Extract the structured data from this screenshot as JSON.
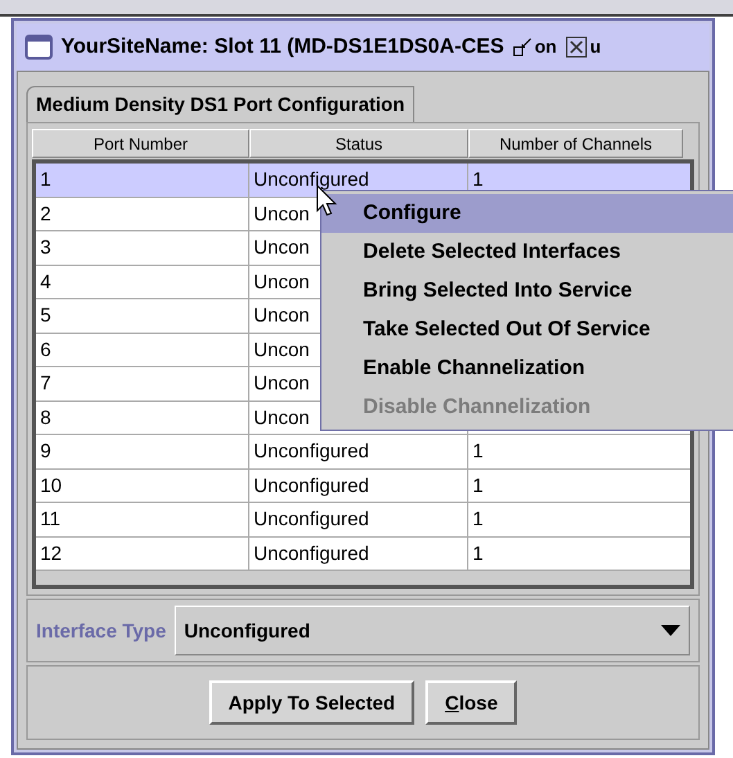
{
  "window": {
    "title": "YourSiteName: Slot 11 (MD-DS1E1DS0A-CES",
    "title_fragments": [
      "on",
      "u"
    ]
  },
  "tabs": [
    {
      "label": "Medium Density DS1 Port Configuration",
      "selected": true
    }
  ],
  "table": {
    "columns": [
      "Port Number",
      "Status",
      "Number of Channels"
    ],
    "rows": [
      {
        "port": "1",
        "status": "Unconfigured",
        "channels": "1",
        "selected": true
      },
      {
        "port": "2",
        "status": "Uncon",
        "selected": false
      },
      {
        "port": "3",
        "status": "Uncon",
        "selected": false
      },
      {
        "port": "4",
        "status": "Uncon",
        "selected": false
      },
      {
        "port": "5",
        "status": "Uncon",
        "selected": false
      },
      {
        "port": "6",
        "status": "Uncon",
        "selected": false
      },
      {
        "port": "7",
        "status": "Uncon",
        "selected": false
      },
      {
        "port": "8",
        "status": "Uncon",
        "selected": false
      },
      {
        "port": "9",
        "status": "Unconfigured",
        "channels": "1",
        "selected": false
      },
      {
        "port": "10",
        "status": "Unconfigured",
        "channels": "1",
        "selected": false
      },
      {
        "port": "11",
        "status": "Unconfigured",
        "channels": "1",
        "selected": false
      },
      {
        "port": "12",
        "status": "Unconfigured",
        "channels": "1",
        "selected": false
      }
    ]
  },
  "context_menu": {
    "items": [
      {
        "label": "Configure",
        "selected": true,
        "disabled": false
      },
      {
        "label": "Delete Selected Interfaces",
        "selected": false,
        "disabled": false
      },
      {
        "label": "Bring Selected Into Service",
        "selected": false,
        "disabled": false
      },
      {
        "label": "Take Selected Out Of Service",
        "selected": false,
        "disabled": false
      },
      {
        "label": "Enable Channelization",
        "selected": false,
        "disabled": false
      },
      {
        "label": "Disable Channelization",
        "selected": false,
        "disabled": true
      }
    ]
  },
  "interface_type": {
    "label": "Interface Type",
    "value": "Unconfigured"
  },
  "buttons": [
    {
      "label": "Apply To Selected"
    },
    {
      "label": "Close",
      "mnemonic_underlined": true
    }
  ]
}
